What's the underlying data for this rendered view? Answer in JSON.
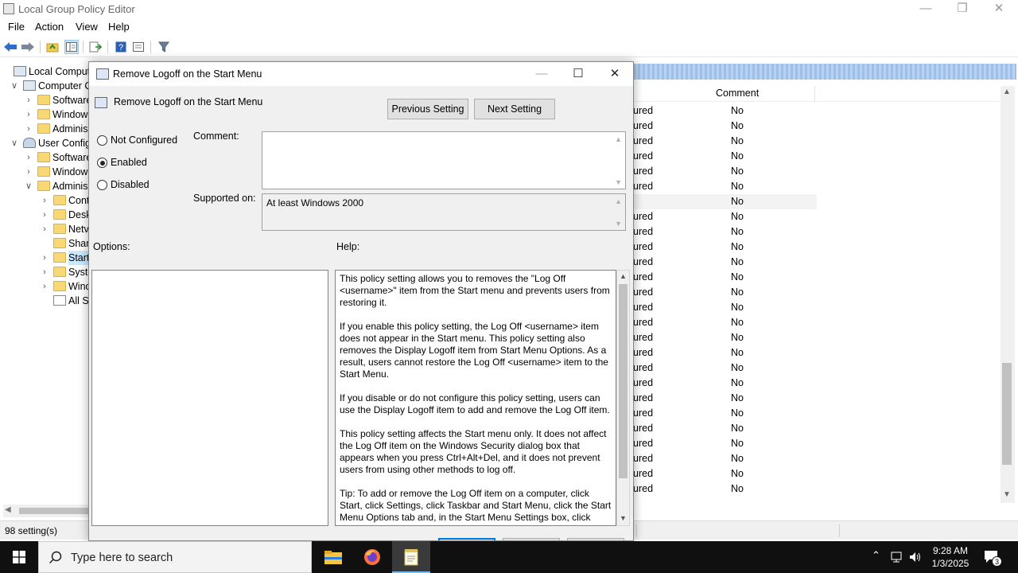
{
  "window": {
    "title": "Local Group Policy Editor",
    "menu": [
      "File",
      "Action",
      "View",
      "Help"
    ]
  },
  "tree": [
    {
      "label": "Local Compute",
      "indent": 0,
      "expander": "",
      "icon": "computer-icon"
    },
    {
      "label": "Computer C",
      "indent": 1,
      "expander": "∨",
      "icon": "computer-icon"
    },
    {
      "label": "Software",
      "indent": 2,
      "expander": "›",
      "icon": "folder-icon"
    },
    {
      "label": "Window",
      "indent": 2,
      "expander": "›",
      "icon": "folder-icon"
    },
    {
      "label": "Adminis",
      "indent": 2,
      "expander": "›",
      "icon": "folder-icon"
    },
    {
      "label": "User Config",
      "indent": 1,
      "expander": "∨",
      "icon": "user-icon"
    },
    {
      "label": "Software",
      "indent": 2,
      "expander": "›",
      "icon": "folder-icon"
    },
    {
      "label": "Window",
      "indent": 2,
      "expander": "›",
      "icon": "folder-icon"
    },
    {
      "label": "Adminis",
      "indent": 2,
      "expander": "∨",
      "icon": "folder-icon"
    },
    {
      "label": "Cont",
      "indent": 3,
      "expander": "›",
      "icon": "folder-icon"
    },
    {
      "label": "Desk",
      "indent": 3,
      "expander": "›",
      "icon": "folder-icon"
    },
    {
      "label": "Netv",
      "indent": 3,
      "expander": "›",
      "icon": "folder-icon"
    },
    {
      "label": "Shar",
      "indent": 3,
      "expander": "",
      "icon": "folder-icon"
    },
    {
      "label": "Start",
      "indent": 3,
      "expander": "›",
      "icon": "folder-icon",
      "selected": true
    },
    {
      "label": "Syste",
      "indent": 3,
      "expander": "›",
      "icon": "folder-icon"
    },
    {
      "label": "Wind",
      "indent": 3,
      "expander": "›",
      "icon": "folder-icon"
    },
    {
      "label": "All S",
      "indent": 3,
      "expander": "",
      "icon": "settings-list-icon"
    }
  ],
  "list": {
    "comment_header": "Comment",
    "rows": [
      {
        "state": "ured",
        "comment": "No"
      },
      {
        "state": "ured",
        "comment": "No"
      },
      {
        "state": "ured",
        "comment": "No"
      },
      {
        "state": "ured",
        "comment": "No"
      },
      {
        "state": "ured",
        "comment": "No"
      },
      {
        "state": "ured",
        "comment": "No"
      },
      {
        "state": "",
        "comment": "No"
      },
      {
        "state": "ured",
        "comment": "No"
      },
      {
        "state": "ured",
        "comment": "No"
      },
      {
        "state": "ured",
        "comment": "No"
      },
      {
        "state": "ured",
        "comment": "No"
      },
      {
        "state": "ured",
        "comment": "No"
      },
      {
        "state": "ured",
        "comment": "No"
      },
      {
        "state": "ured",
        "comment": "No"
      },
      {
        "state": "ured",
        "comment": "No"
      },
      {
        "state": "ured",
        "comment": "No"
      },
      {
        "state": "ured",
        "comment": "No"
      },
      {
        "state": "ured",
        "comment": "No"
      },
      {
        "state": "ured",
        "comment": "No"
      },
      {
        "state": "ured",
        "comment": "No"
      },
      {
        "state": "ured",
        "comment": "No"
      },
      {
        "state": "ured",
        "comment": "No"
      },
      {
        "state": "ured",
        "comment": "No"
      },
      {
        "state": "ured",
        "comment": "No"
      },
      {
        "state": "ured",
        "comment": "No"
      },
      {
        "state": "ured",
        "comment": "No"
      }
    ]
  },
  "status": {
    "text": "98 setting(s)"
  },
  "dialog": {
    "title": "Remove Logoff on the Start Menu",
    "policy_name": "Remove Logoff on the Start Menu",
    "previous_label": "Previous Setting",
    "next_label": "Next Setting",
    "radios": [
      {
        "label": "Not Configured",
        "checked": false
      },
      {
        "label": "Enabled",
        "checked": true
      },
      {
        "label": "Disabled",
        "checked": false
      }
    ],
    "comment_label": "Comment:",
    "comment_value": "",
    "supported_label": "Supported on:",
    "supported_value": "At least Windows 2000",
    "options_label": "Options:",
    "help_label": "Help:",
    "help_text": "This policy setting allows you to removes the \"Log Off <username>\" item from the Start menu and prevents users from restoring it.\n\nIf you enable this policy setting, the Log Off <username> item does not appear in the Start menu. This policy setting also removes the Display Logoff item from Start Menu Options. As a result, users cannot restore the Log Off <username> item to the Start Menu.\n\nIf you disable or do not configure this policy setting, users can use the Display Logoff item to add and remove the Log Off item.\n\nThis policy setting affects the Start menu only. It does not affect the Log Off item on the Windows Security dialog box that appears when you press Ctrl+Alt+Del, and it does not prevent users from using other methods to log off.\n\nTip: To add or remove the Log Off item on a computer, click Start, click Settings, click Taskbar and Start Menu, click the Start Menu Options tab and, in the Start Menu Settings box, click Display Logoff."
  },
  "taskbar": {
    "search_placeholder": "Type here to search",
    "time": "9:28 AM",
    "date": "1/3/2025",
    "notifications": "3"
  }
}
